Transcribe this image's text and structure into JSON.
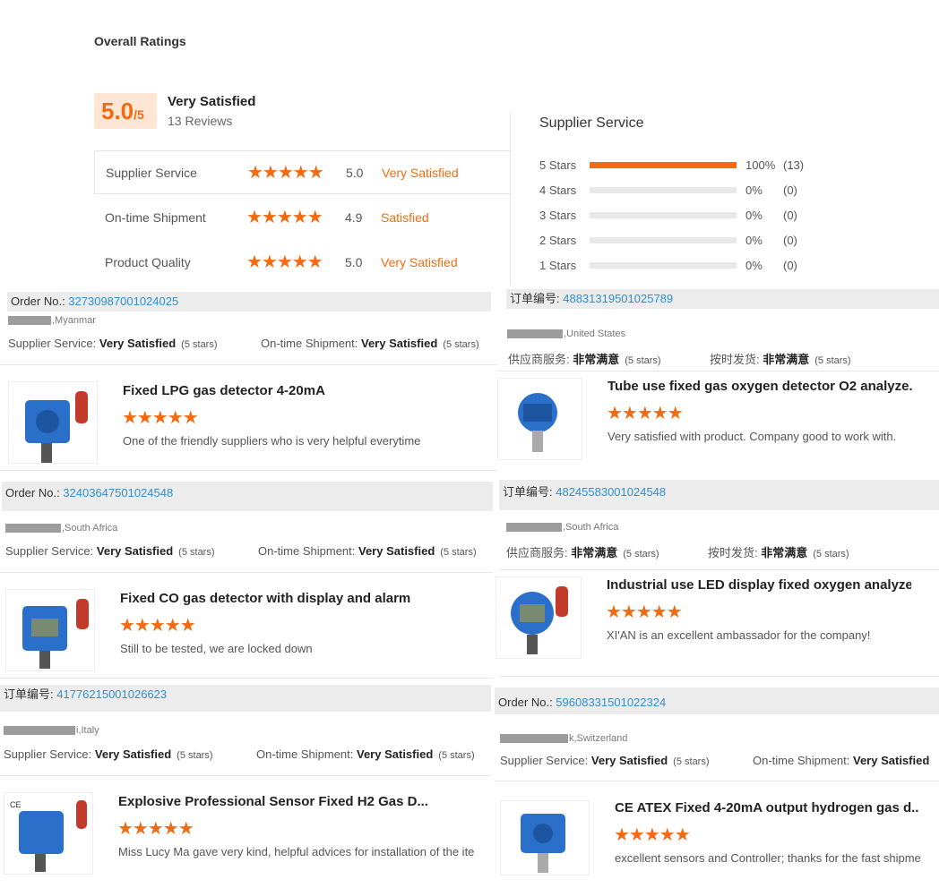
{
  "summary": {
    "title": "Overall Ratings",
    "score": "5.0",
    "score_suffix": "/5",
    "satisfaction": "Very Satisfied",
    "reviews": "13 Reviews",
    "rows": [
      {
        "label": "Supplier Service",
        "stars": "★★★★★",
        "value": "5.0",
        "status": "Very Satisfied"
      },
      {
        "label": "On-time Shipment",
        "stars": "★★★★★",
        "value": "4.9",
        "status": "Satisfied"
      },
      {
        "label": "Product Quality",
        "stars": "★★★★★",
        "value": "5.0",
        "status": "Very Satisfied"
      }
    ]
  },
  "supplier_service": {
    "title": "Supplier Service",
    "bars": [
      {
        "label": "5 Stars",
        "fraction": 1.0,
        "pct": "100%",
        "count": "(13)"
      },
      {
        "label": "4 Stars",
        "fraction": 0,
        "pct": "0%",
        "count": "(0)"
      },
      {
        "label": "3 Stars",
        "fraction": 0,
        "pct": "0%",
        "count": "(0)"
      },
      {
        "label": "2 Stars",
        "fraction": 0,
        "pct": "0%",
        "count": "(0)"
      },
      {
        "label": "1 Stars",
        "fraction": 0,
        "pct": "0%",
        "count": "(0)"
      }
    ]
  },
  "reviews": [
    {
      "order_label": "Order No.: ",
      "order_no": "32730987001024025",
      "buyer": ",Myanmar",
      "svc_label": "Supplier Service: ",
      "svc_value": "Very Satisfied",
      "svc_stars": "(5 stars)",
      "ship_label": "On-time Shipment: ",
      "ship_value": "Very Satisfied",
      "ship_stars": "(5 stars)",
      "product": "Fixed LPG gas detector 4-20mA",
      "stars": "★★★★★",
      "comment": "One of the friendly suppliers who is very helpful everytime"
    },
    {
      "order_label": "订单编号: ",
      "order_no": "48831319501025789",
      "buyer": ",United States",
      "svc_label": "供应商服务: ",
      "svc_value": "非常满意",
      "svc_stars": "(5 stars)",
      "ship_label": "按时发货: ",
      "ship_value": "非常满意",
      "ship_stars": "(5 stars)",
      "product": "Tube use fixed gas oxygen detector O2 analyze...",
      "stars": "★★★★★",
      "comment": "Very satisfied with product. Company good to work with."
    },
    {
      "order_label": "Order No.: ",
      "order_no": "32403647501024548",
      "buyer": ",South Africa",
      "svc_label": "Supplier Service: ",
      "svc_value": "Very Satisfied",
      "svc_stars": "(5 stars)",
      "ship_label": "On-time Shipment: ",
      "ship_value": "Very Satisfied",
      "ship_stars": "(5 stars)",
      "product": "Fixed CO gas detector with display and alarm",
      "stars": "★★★★★",
      "comment": "Still to be tested, we are locked down"
    },
    {
      "order_label": "订单编号: ",
      "order_no": "48245583001024548",
      "buyer": ",South Africa",
      "svc_label": "供应商服务: ",
      "svc_value": "非常满意",
      "svc_stars": "(5 stars)",
      "ship_label": "按时发货: ",
      "ship_value": "非常满意",
      "ship_stars": "(5 stars)",
      "product": "Industrial use LED display fixed oxygen analyze...",
      "stars": "★★★★★",
      "comment": "XI'AN is an excellent ambassador for the company!"
    },
    {
      "order_label": "订单编号: ",
      "order_no": "41776215001026623",
      "buyer": "i,Italy",
      "svc_label": "Supplier Service: ",
      "svc_value": "Very Satisfied",
      "svc_stars": "(5 stars)",
      "ship_label": "On-time Shipment: ",
      "ship_value": "Very Satisfied",
      "ship_stars": "(5 stars)",
      "product": "Explosive Professional Sensor Fixed H2 Gas D...",
      "stars": "★★★★★",
      "comment": "Miss Lucy Ma gave very kind, helpful advices for installation of the ite"
    },
    {
      "order_label": "Order No.: ",
      "order_no": "59608331501022324",
      "buyer": "k,Switzerland",
      "svc_label": "Supplier Service: ",
      "svc_value": "Very Satisfied",
      "svc_stars": "(5 stars)",
      "ship_label": "On-time Shipment: ",
      "ship_value": "Very Satisfied",
      "ship_stars": "",
      "product": "CE ATEX Fixed 4-20mA output hydrogen gas d...",
      "stars": "★★★★★",
      "comment": "excellent sensors and Controller; thanks for the fast shipme"
    }
  ],
  "colors": {
    "accent": "#f26b11",
    "link": "#2e8fd0",
    "detector_blue": "#2a6fc9"
  }
}
